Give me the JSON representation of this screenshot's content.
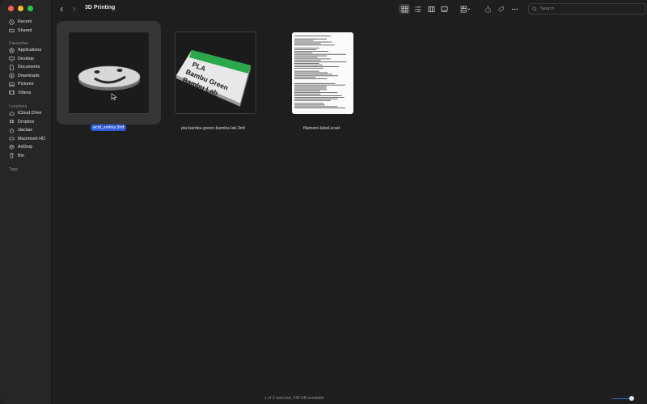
{
  "window": {
    "title": "3D Printing"
  },
  "sidebar": {
    "favourites_label": "Favourites",
    "favourites": [
      {
        "label": "Recent",
        "icon": "clock-icon"
      },
      {
        "label": "Shared",
        "icon": "shared-folder-icon"
      }
    ],
    "favourites2": [
      {
        "label": "Applications",
        "icon": "applications-icon"
      },
      {
        "label": "Desktop",
        "icon": "desktop-icon"
      },
      {
        "label": "Documents",
        "icon": "document-icon"
      },
      {
        "label": "Downloads",
        "icon": "download-icon"
      },
      {
        "label": "Pictures",
        "icon": "pictures-icon"
      },
      {
        "label": "Videos",
        "icon": "videos-icon"
      }
    ],
    "locations_label": "Locations",
    "locations": [
      {
        "label": "iCloud Drive",
        "icon": "cloud-icon"
      },
      {
        "label": "Dropbox",
        "icon": "dropbox-icon"
      },
      {
        "label": "slackas",
        "icon": "home-icon"
      },
      {
        "label": "Macintosh HD",
        "icon": "disk-icon"
      },
      {
        "label": "AirDrop",
        "icon": "airdrop-icon"
      },
      {
        "label": "Bin",
        "icon": "trash-icon"
      }
    ],
    "tags_label": "Tags"
  },
  "toolbar": {
    "search_placeholder": "Search",
    "view_mode": "icon"
  },
  "files": [
    {
      "name": "acid_smiley.3mf",
      "selected": true
    },
    {
      "name": "pla-bambu-green-bambu-lab.3mf",
      "selected": false,
      "label_lines": [
        "PLA",
        "Bambu Green",
        "Bambu Lab"
      ]
    },
    {
      "name": "filament-label.scad",
      "selected": false
    }
  ],
  "status": {
    "text": "1 of 3 selected, 248 GB available"
  },
  "zoom": {
    "value": 0.85
  },
  "colors": {
    "accent": "#2f5bd8",
    "label_green": "#2aa84a"
  }
}
